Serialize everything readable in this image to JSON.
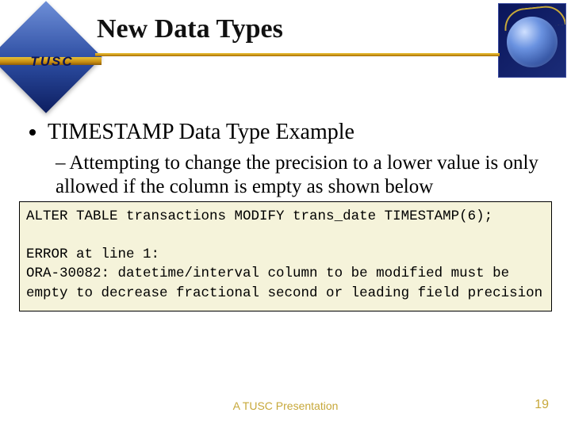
{
  "brand": "TUSC",
  "title": "New Data Types",
  "bullet_main": "TIMESTAMP Data Type Example",
  "bullet_sub": "Attempting to change the precision to a lower value is only allowed if the column is empty as shown below",
  "code": "ALTER TABLE transactions MODIFY trans_date TIMESTAMP(6);\n\nERROR at line 1:\nORA-30082: datetime/interval column to be modified must be empty to decrease fractional second or leading field precision",
  "footer": "A TUSC Presentation",
  "page_number": "19"
}
